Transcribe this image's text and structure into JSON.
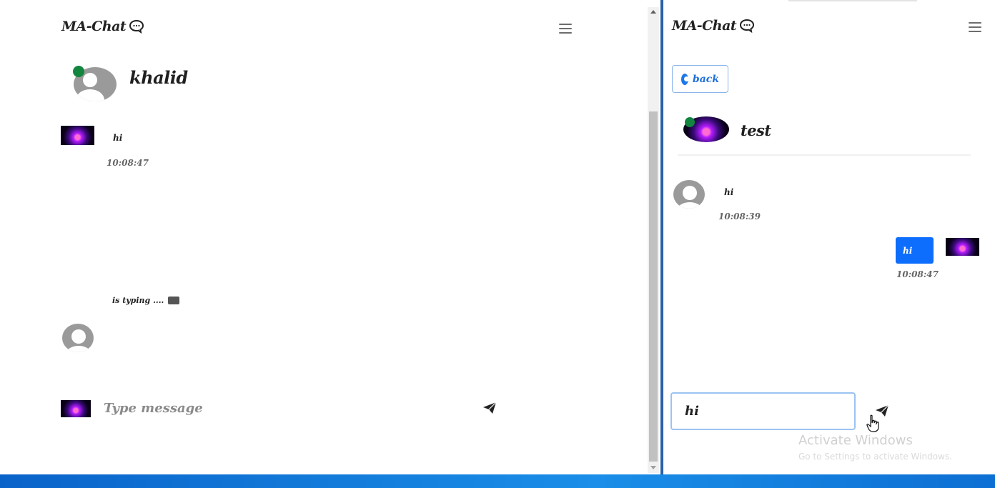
{
  "left_window": {
    "brand": "MA-Chat",
    "contact": {
      "name": "khalid",
      "online": true
    },
    "messages": [
      {
        "from": "self",
        "text": "hi",
        "time": "10:08:47"
      }
    ],
    "typing_indicator": "is typing ....",
    "composer": {
      "placeholder": "Type message"
    }
  },
  "right_window": {
    "brand": "MA-Chat",
    "back_label": "back",
    "contact": {
      "name": "test",
      "online": true
    },
    "messages": [
      {
        "from": "contact",
        "text": "hi",
        "time": "10:08:39"
      },
      {
        "from": "self",
        "text": "hi",
        "time": "10:08:47"
      }
    ],
    "composer": {
      "value": "hi"
    }
  },
  "watermark": {
    "line1": "Activate Windows",
    "line2": "Go to Settings to activate Windows."
  },
  "colors": {
    "accent": "#0d6efd",
    "online": "#12853f",
    "divider": "#2b5fa8",
    "taskbar": "#1a8ee8"
  },
  "icons": [
    "chat-bubble-icon",
    "hamburger-menu-icon",
    "send-icon",
    "back-circle-icon",
    "keyboard-icon"
  ]
}
